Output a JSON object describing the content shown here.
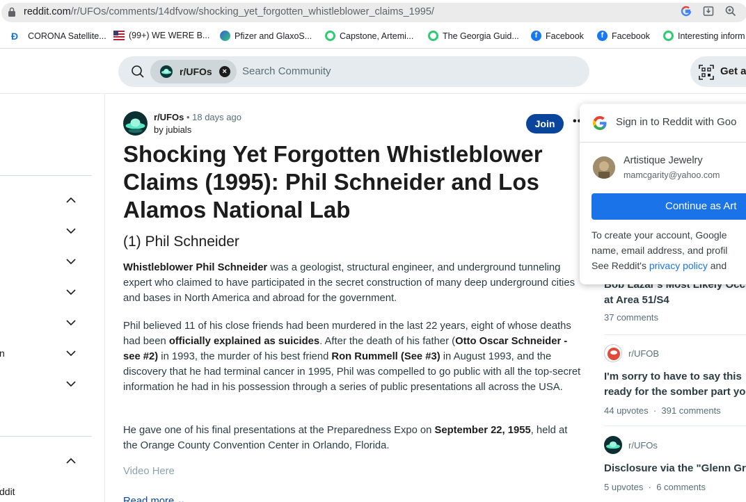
{
  "browser": {
    "url_domain": "reddit.com",
    "url_path": "/r/UFOs/comments/14dfvow/shocking_yet_forgotten_whistleblower_claims_1995/",
    "bookmarks": [
      {
        "label": "CORONA Satellite...",
        "icon": "d-icon",
        "color": "#1a73e8"
      },
      {
        "label": "(99+) WE WERE B...",
        "icon": "flag-icon",
        "color": "#b22234"
      },
      {
        "label": "Pfizer and GlaxoS...",
        "icon": "edge-icon",
        "color": "#3b5bdb"
      },
      {
        "label": "Capstone, Artemi...",
        "icon": "green-circle-icon",
        "color": "#2ecc71"
      },
      {
        "label": "The Georgia Guid...",
        "icon": "green-circle-icon",
        "color": "#2ecc71"
      },
      {
        "label": "Facebook",
        "icon": "facebook-icon",
        "color": "#1877f2"
      },
      {
        "label": "Facebook",
        "icon": "facebook-icon",
        "color": "#1877f2"
      },
      {
        "label": "Interesting inform",
        "icon": "green-circle-icon",
        "color": "#2ecc71"
      }
    ]
  },
  "header": {
    "community_chip": "r/UFOs",
    "search_placeholder": "Search Community",
    "get_app_label": "Get a"
  },
  "sidebar": {
    "partial_label_1": "n",
    "partial_label_2": "ddit"
  },
  "post": {
    "subreddit": "r/UFOs",
    "age": "• 18 days ago",
    "author": "by jubials",
    "join_label": "Join",
    "more_label": "•••",
    "title": "Shocking Yet Forgotten Whistleblower Claims (1995): Phil Schneider and Los Alamos National Lab",
    "heading": "(1) Phil Schneider",
    "p1_bold": "Whistleblower Phil Schneider",
    "p1_rest": " was a geologist, structural engineer, and underground tunneling expert who claimed to have participated in the secret construction of many deep underground cities and bases in North America and abroad for the government.",
    "p2_a": "Phil believed 11 of his close friends had been murdered in the last 22 years, eight of whose deaths had been ",
    "p2_b": "officially explained as suicides",
    "p2_c": ". After the death of his father (",
    "p2_d": "Otto Oscar Schneider - see #2)",
    "p2_e": " in 1993, the murder of his best friend ",
    "p2_f": "Ron Rummell (See #3)",
    "p2_g": " in August 1993, and the discovery that he had terminal cancer in 1995, Phil was compelled to go public with all the top-secret information he had in his possession through a series of public presentations all across the USA.",
    "p3_a": "He gave one of his final presentations at the Preparedness Expo on ",
    "p3_b": "September 22, 1955",
    "p3_c": ", held at the Orange County Convention Center in Orlando, Florida.",
    "video": "Video Here",
    "read_more": "Read more ⌄"
  },
  "feed": [
    {
      "title_1": "Bob Lazar's Most Likely Occ",
      "title_2": "at Area 51/S4",
      "meta": "37 comments"
    },
    {
      "sub": "r/UFOB",
      "title_1": "I'm sorry to have to say this",
      "title_2": "ready for the somber part yo",
      "upvotes": "44 upvotes",
      "dot": "·",
      "comments": "391 comments"
    },
    {
      "sub": "r/UFOs",
      "title_1": "Disclosure via the \"Glenn Gr",
      "upvotes": "5 upvotes",
      "dot": "·",
      "comments": "6 comments"
    }
  ],
  "google_popup": {
    "title": "Sign in to Reddit with Goo",
    "name": "Artistique Jewelry",
    "email": "mamcgarity@yahoo.com",
    "continue": "Continue as Art",
    "line1": "To create your account, Google",
    "line2": "name, email address, and profil",
    "line3_a": "See Reddit's ",
    "line3_link": "privacy policy",
    "line3_b": " and"
  },
  "colors": {
    "accent": "#0a449b",
    "google_blue": "#1a73e8",
    "search_bg": "#e5ebee"
  }
}
